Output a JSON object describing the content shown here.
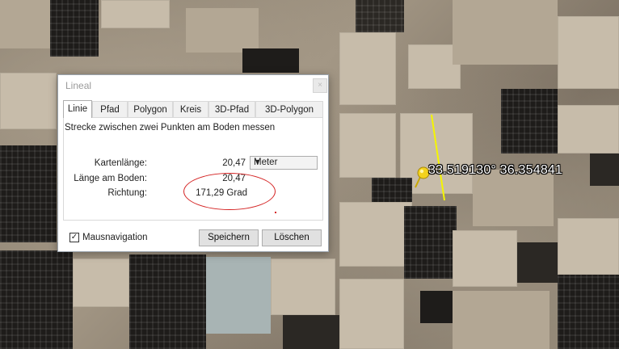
{
  "dialog": {
    "title": "Lineal",
    "close_glyph": "×",
    "tabs": [
      {
        "label": "Linie",
        "active": true
      },
      {
        "label": "Pfad",
        "active": false
      },
      {
        "label": "Polygon",
        "active": false
      },
      {
        "label": "Kreis",
        "active": false
      },
      {
        "label": "3D-Pfad",
        "active": false
      },
      {
        "label": "3D-Polygon",
        "active": false
      }
    ],
    "description": "Strecke zwischen zwei Punkten am Boden messen",
    "map_length_label": "Kartenlänge:",
    "map_length_value": "20,47",
    "unit_select": {
      "selected": "Meter",
      "arrow": "▼"
    },
    "ground_length_label": "Länge am Boden:",
    "ground_length_value": "20,47",
    "heading_label": "Richtung:",
    "heading_value": "171,29 Grad",
    "mouse_nav_checkbox": {
      "label": "Mausnavigation",
      "checked": true,
      "mark": "✓"
    },
    "save_button": "Speichern",
    "clear_button": "Löschen"
  },
  "map": {
    "coordinate_label": "33.519130° 36.354841",
    "measure_line_color": "#f5f500",
    "annotation_color": "#d42222"
  }
}
